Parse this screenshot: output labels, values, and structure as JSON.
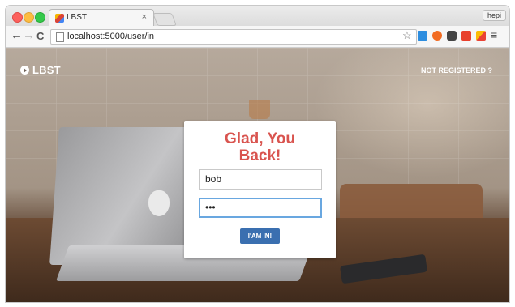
{
  "browser": {
    "tab_title": "LBST",
    "tab_close_icon": "×",
    "profile_label": "hepi",
    "url": "localhost:5000/user/in"
  },
  "page": {
    "brand": "LBST",
    "not_registered_link": "NOT REGISTERED ?",
    "card": {
      "title_line1": "Glad, You",
      "title_line2": "Back!",
      "username_value": "bob",
      "password_value": "•••",
      "submit_label": "I'AM IN!"
    }
  },
  "colors": {
    "title_red": "#d9544f",
    "button_blue": "#3a6fb0",
    "focus_blue": "#69a7e0"
  },
  "icons": {
    "back": "arrow-left-icon",
    "forward": "arrow-right-icon",
    "reload": "reload-icon",
    "bookmark": "star-icon",
    "menu": "hamburger-menu-icon"
  }
}
